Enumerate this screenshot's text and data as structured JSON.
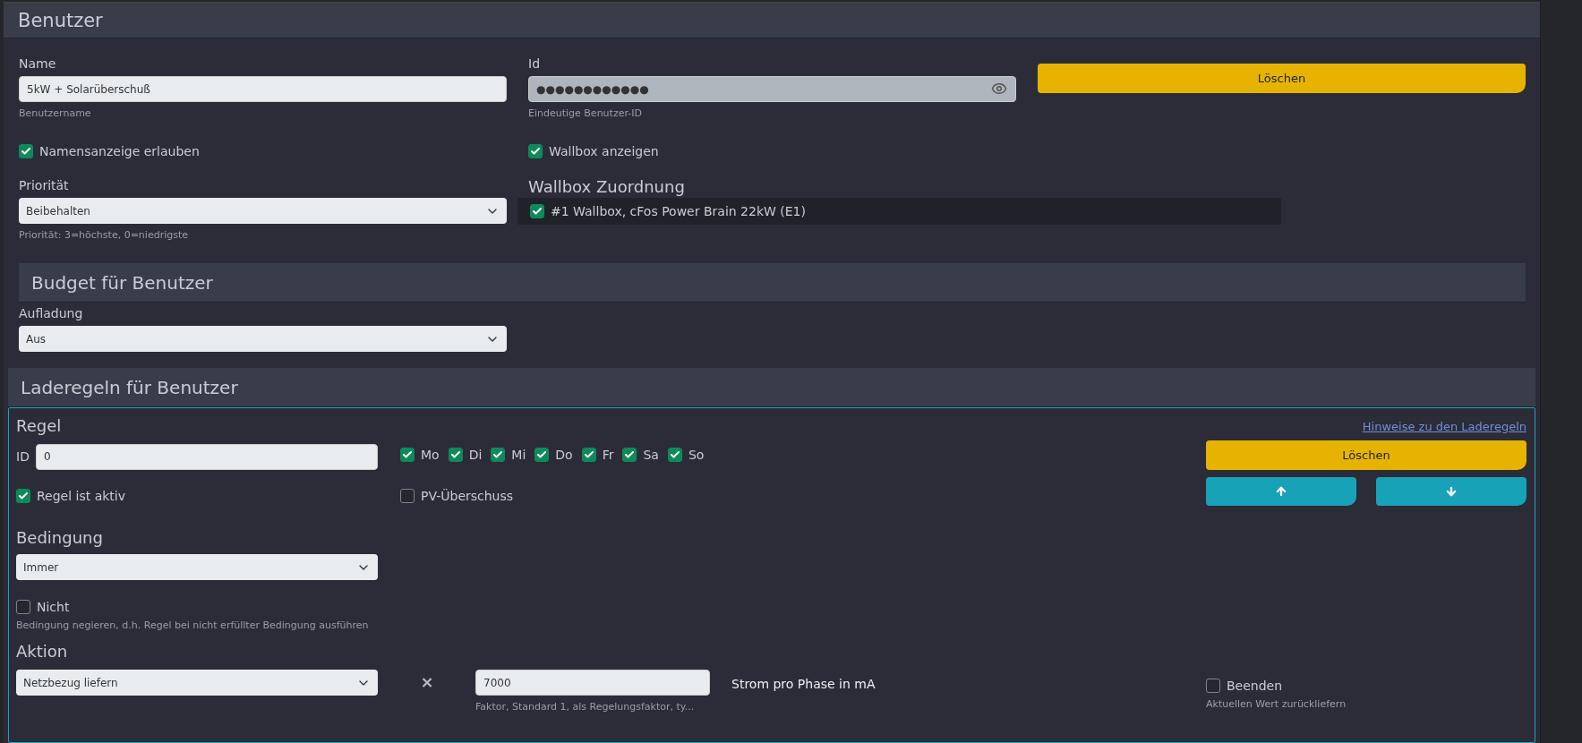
{
  "header": {
    "title": "Benutzer"
  },
  "name": {
    "label": "Name",
    "value": "5kW + Solarüberschuß",
    "hint": "Benutzername"
  },
  "id": {
    "label": "Id",
    "value": "●●●●●●●●●●●●",
    "hint": "Eindeutige Benutzer-ID"
  },
  "delete_button": "Löschen",
  "display_options": [
    {
      "label": "Namensanzeige erlauben",
      "checked": true
    },
    {
      "label": "Wallbox anzeigen",
      "checked": true
    }
  ],
  "priority": {
    "label": "Priorität",
    "value": "Beibehalten",
    "hint": "Priorität: 3=höchste, 0=niedrigste"
  },
  "wallbox_assignment": {
    "title": "Wallbox Zuordnung",
    "items": [
      {
        "label": "#1 Wallbox, cFos Power Brain 22kW (E1)",
        "checked": true
      }
    ]
  },
  "budget": {
    "title": "Budget für Benutzer",
    "charging": {
      "label": "Aufladung",
      "value": "Aus"
    }
  },
  "rules": {
    "title": "Laderegeln für Benutzer",
    "rule": {
      "title": "Regel",
      "help_link": "Hinweise zu den Laderegeln",
      "id_label": "ID",
      "id_value": "0",
      "days": [
        {
          "label": "Mo",
          "checked": true
        },
        {
          "label": "Di",
          "checked": true
        },
        {
          "label": "Mi",
          "checked": true
        },
        {
          "label": "Do",
          "checked": true
        },
        {
          "label": "Fr",
          "checked": true
        },
        {
          "label": "Sa",
          "checked": true
        },
        {
          "label": "So",
          "checked": true
        }
      ],
      "active": {
        "label": "Regel ist aktiv",
        "checked": true
      },
      "pv_surplus": {
        "label": "PV-Überschuss",
        "checked": false
      },
      "delete_button": "Löschen",
      "condition": {
        "title": "Bedingung",
        "value": "Immer",
        "negate": {
          "label": "Nicht",
          "checked": false
        },
        "hint": "Bedingung negieren, d.h. Regel bei nicht erfüllter Bedingung ausführen"
      },
      "action": {
        "title": "Aktion",
        "value": "Netzbezug liefern",
        "operator": "×",
        "amount": "7000",
        "amount_hint": "Faktor, Standard 1, als Regelungsfaktor, ty...",
        "unit_label": "Strom pro Phase in mA",
        "end": {
          "label": "Beenden",
          "checked": false
        },
        "end_hint": "Aktuellen Wert zurückliefern"
      }
    }
  }
}
